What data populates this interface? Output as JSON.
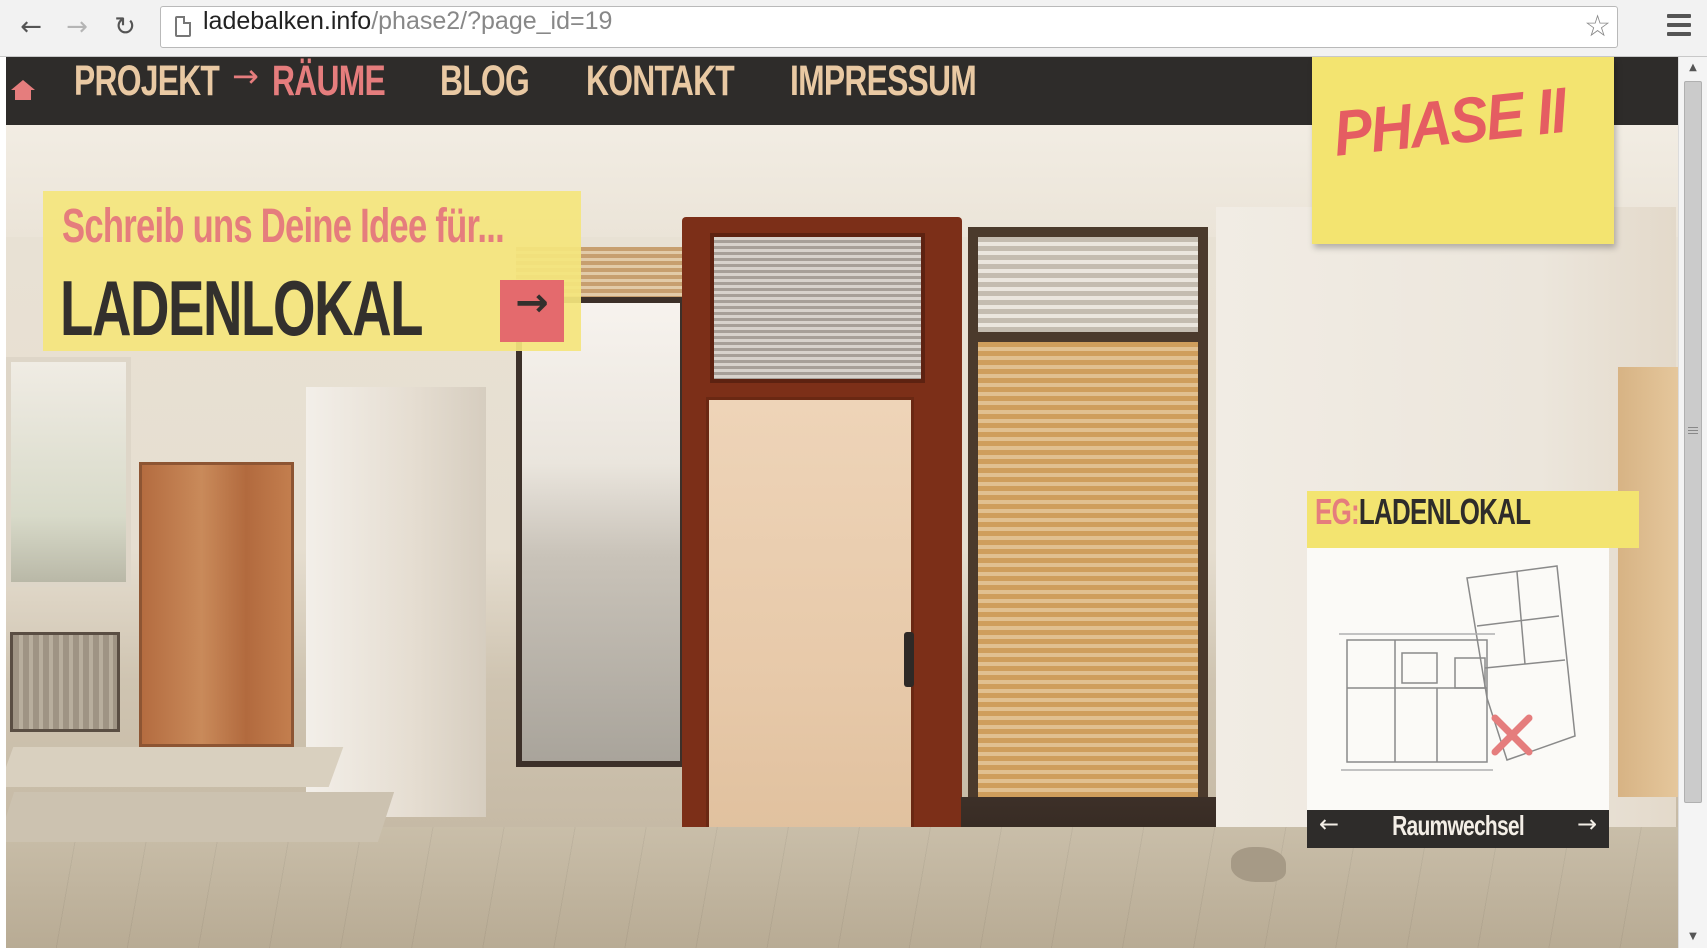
{
  "browser": {
    "url_host": "ladebalken.info",
    "url_path": "/phase2/?page_id=19",
    "back_icon": "arrow-left-icon",
    "forward_icon": "arrow-right-icon",
    "reload_icon": "reload-icon",
    "bookmark_icon": "star-icon",
    "menu_icon": "hamburger-menu-icon",
    "back_glyph": "←",
    "forward_glyph": "→",
    "reload_glyph": "↻",
    "star_glyph": "☆"
  },
  "site_nav": {
    "home_icon": "home-icon",
    "items": [
      {
        "label": "PROJEKT",
        "active": false
      },
      {
        "label": "RÄUME",
        "active": true
      },
      {
        "label": "BLOG",
        "active": false
      },
      {
        "label": "KONTAKT",
        "active": false
      },
      {
        "label": "IMPRESSUM",
        "active": false
      }
    ],
    "active_arrow": "→"
  },
  "logo": {
    "text": "PHASE II"
  },
  "idea_box": {
    "prompt": "Schreib uns Deine Idee für...",
    "room": "LADENLOKAL",
    "go_glyph": "→"
  },
  "plan_panel": {
    "floor_code": "EG:",
    "room_name": "LADENLOKAL",
    "prev_glyph": "←",
    "next_glyph": "→",
    "switch_label": "Raumwechsel",
    "marker_icon": "x-marker-icon"
  },
  "colors": {
    "nav_bg": "#2e2c2a",
    "nav_text": "#e9c9a3",
    "accent_pink": "#e57d7d",
    "sticky_yellow": "#f3e470",
    "dark_text": "#33302d"
  }
}
